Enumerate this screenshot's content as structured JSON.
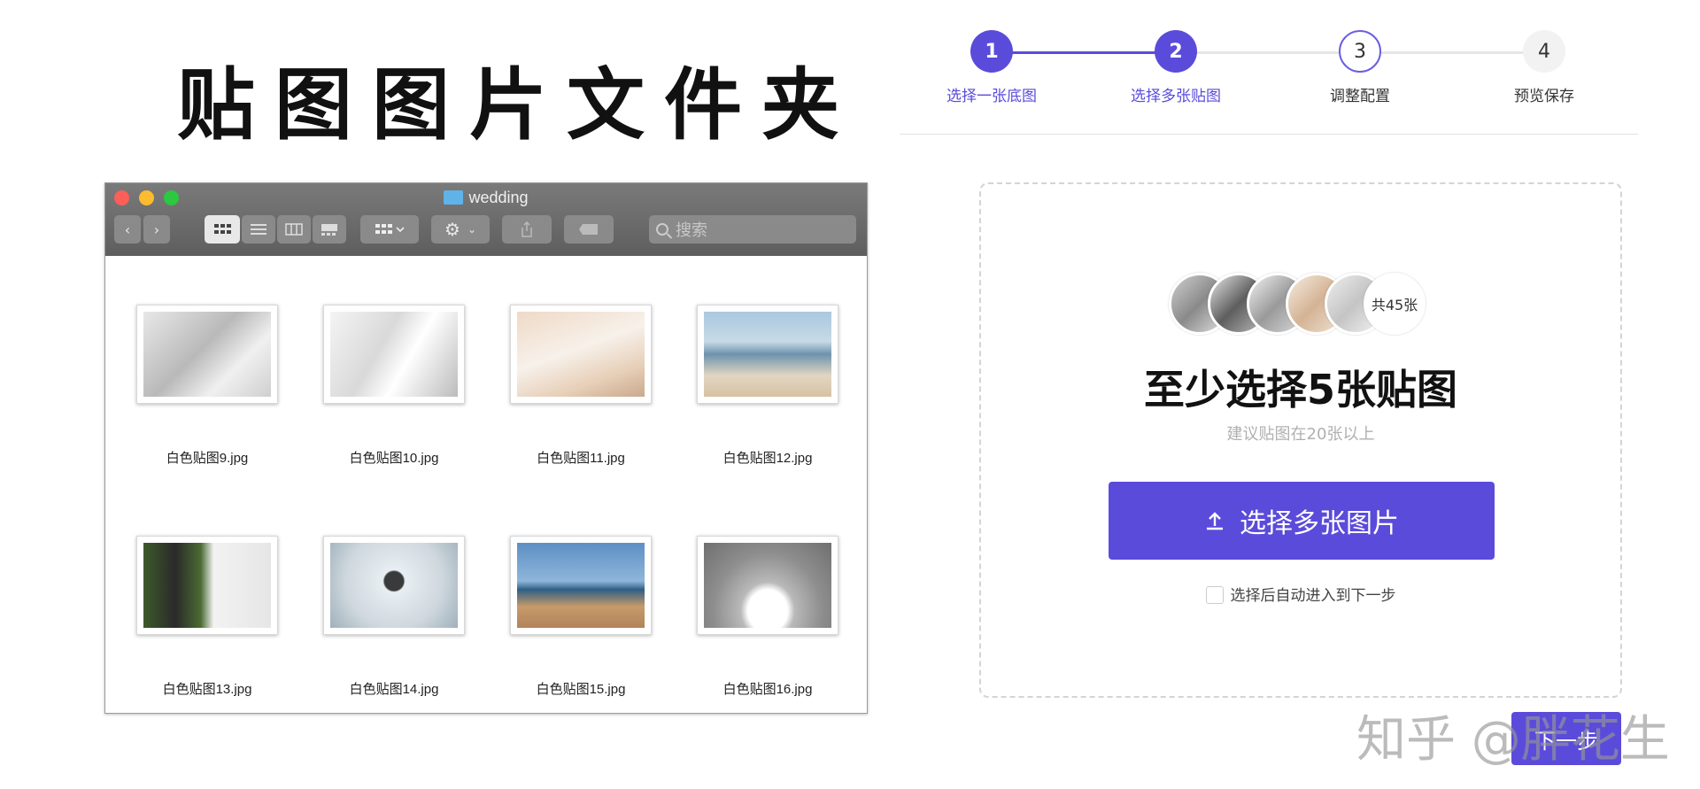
{
  "page": {
    "title": "贴图图片文件夹"
  },
  "finder": {
    "window_title": "wedding",
    "search_placeholder": "搜索",
    "files": [
      {
        "name": "白色贴图9.jpg"
      },
      {
        "name": "白色贴图10.jpg"
      },
      {
        "name": "白色贴图11.jpg"
      },
      {
        "name": "白色贴图12.jpg"
      },
      {
        "name": "白色贴图13.jpg"
      },
      {
        "name": "白色贴图14.jpg"
      },
      {
        "name": "白色贴图15.jpg"
      },
      {
        "name": "白色贴图16.jpg"
      }
    ]
  },
  "stepper": {
    "steps": [
      {
        "number": "1",
        "label": "选择一张底图",
        "state": "done"
      },
      {
        "number": "2",
        "label": "选择多张贴图",
        "state": "done"
      },
      {
        "number": "3",
        "label": "调整配置",
        "state": "current"
      },
      {
        "number": "4",
        "label": "预览保存",
        "state": "pending"
      }
    ]
  },
  "upload": {
    "count_badge": "共45张",
    "title": "至少选择5张贴图",
    "subtitle": "建议贴图在20张以上",
    "button_label": "选择多张图片",
    "auto_next_label": "选择后自动进入到下一步"
  },
  "footer": {
    "next_button_label": "下一步",
    "watermark": "知乎 @胖花生"
  },
  "colors": {
    "accent": "#5b4bdb",
    "accent_text": "#5b4bdb"
  }
}
